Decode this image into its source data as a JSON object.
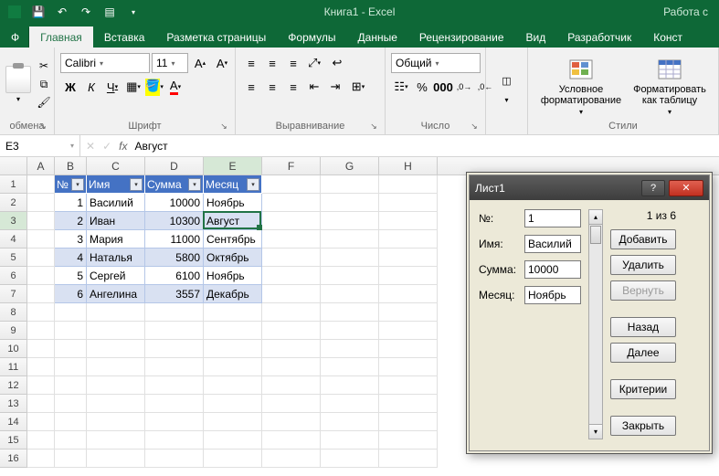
{
  "title": "Книга1 - Excel",
  "titleRight": "Работа с",
  "tabs": {
    "file": "Ф",
    "home": "Главная",
    "insert": "Вставка",
    "pageLayout": "Разметка страницы",
    "formulas": "Формулы",
    "data": "Данные",
    "review": "Рецензирование",
    "view": "Вид",
    "developer": "Разработчик",
    "more": "Конст"
  },
  "ribbon": {
    "clipboard": {
      "label": "обмена"
    },
    "font": {
      "label": "Шрифт",
      "name": "Calibri",
      "size": "11",
      "bold": "Ж",
      "italic": "К",
      "underline": "Ч"
    },
    "alignment": {
      "label": "Выравнивание"
    },
    "number": {
      "label": "Число",
      "format": "Общий"
    },
    "styles": {
      "label": "Стили",
      "cond": "Условное форматирование",
      "table": "Форматировать как таблицу"
    }
  },
  "nameBox": "E3",
  "formula": "Август",
  "colHeaders": [
    "A",
    "B",
    "C",
    "D",
    "E",
    "F",
    "G",
    "H"
  ],
  "rowCount": 16,
  "table": {
    "headers": [
      "№",
      "Имя",
      "Сумма",
      "Месяц"
    ],
    "rows": [
      {
        "n": "1",
        "name": "Василий",
        "sum": "10000",
        "month": "Ноябрь"
      },
      {
        "n": "2",
        "name": "Иван",
        "sum": "10300",
        "month": "Август"
      },
      {
        "n": "3",
        "name": "Мария",
        "sum": "11000",
        "month": "Сентябрь"
      },
      {
        "n": "4",
        "name": "Наталья",
        "sum": "5800",
        "month": "Октябрь"
      },
      {
        "n": "5",
        "name": "Сергей",
        "sum": "6100",
        "month": "Ноябрь"
      },
      {
        "n": "6",
        "name": "Ангелина",
        "sum": "3557",
        "month": "Декабрь"
      }
    ]
  },
  "dialog": {
    "title": "Лист1",
    "counter": "1 из 6",
    "labels": {
      "n": "№:",
      "name": "Имя:",
      "sum": "Сумма:",
      "month": "Месяц:"
    },
    "values": {
      "n": "1",
      "name": "Василий",
      "sum": "10000",
      "month": "Ноябрь"
    },
    "buttons": {
      "add": "Добавить",
      "delete": "Удалить",
      "restore": "Вернуть",
      "prev": "Назад",
      "next": "Далее",
      "criteria": "Критерии",
      "close": "Закрыть"
    }
  }
}
